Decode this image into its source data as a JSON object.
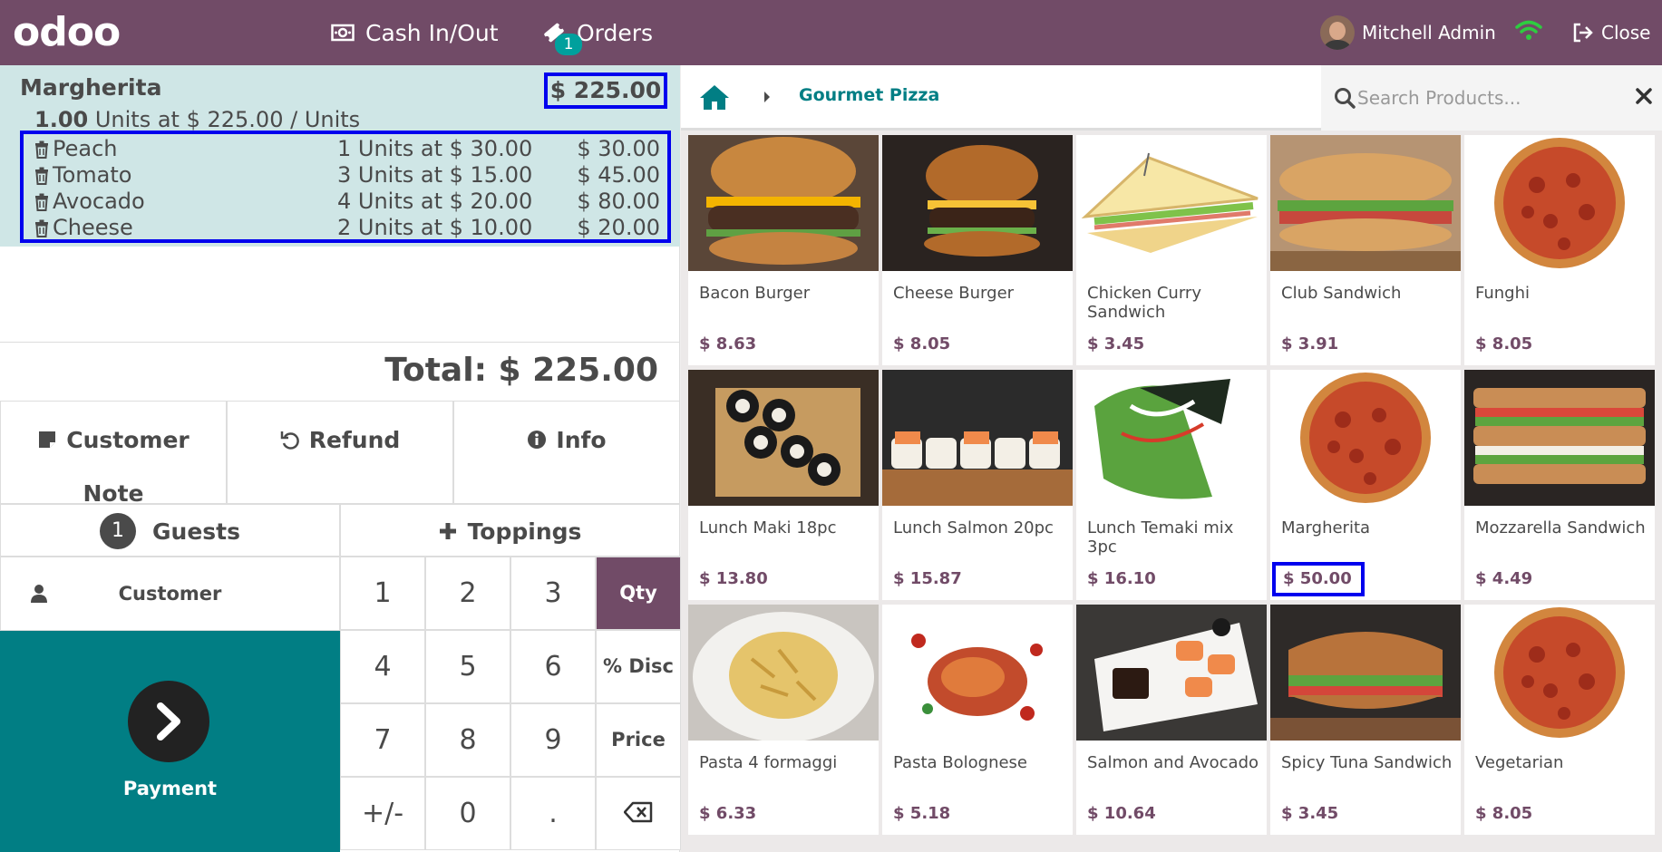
{
  "topbar": {
    "logo": "odoo",
    "cash_label": "Cash In/Out",
    "orders_label": "Orders",
    "orders_count": "1",
    "user_name": "Mitchell Admin",
    "close_label": "Close"
  },
  "order": {
    "line_name": "Margherita",
    "line_price": "$ 225.00",
    "line_qty": "1.00",
    "line_info": "Units at $ 225.00 / Units",
    "toppings": [
      {
        "name": "Peach",
        "qty": "1 Units at $ 30.00",
        "price": "$ 30.00"
      },
      {
        "name": "Tomato",
        "qty": "3 Units at $ 15.00",
        "price": "$ 45.00"
      },
      {
        "name": "Avocado",
        "qty": "4 Units at $ 20.00",
        "price": "$ 80.00"
      },
      {
        "name": "Cheese",
        "qty": "2 Units at $ 10.00",
        "price": "$ 20.00"
      }
    ],
    "total": "Total: $ 225.00"
  },
  "controls": {
    "customer_note_1": "Customer",
    "customer_note_2": "Note",
    "refund": "Refund",
    "info": "Info",
    "guests_count": "1",
    "guests": "Guests",
    "toppings": "Toppings",
    "customer": "Customer",
    "payment": "Payment"
  },
  "numpad": {
    "keys": [
      "1",
      "2",
      "3",
      "4",
      "5",
      "6",
      "7",
      "8",
      "9",
      "+/-",
      "0",
      "."
    ],
    "modes": [
      "Qty",
      "% Disc",
      "Price"
    ],
    "active_mode": "Qty"
  },
  "products_header": {
    "breadcrumb": "Gourmet Pizza",
    "search_placeholder": "Search Products..."
  },
  "products": [
    {
      "name": "Bacon Burger",
      "price": "$ 8.63"
    },
    {
      "name": "Cheese Burger",
      "price": "$ 8.05"
    },
    {
      "name": "Chicken Curry Sandwich",
      "price": "$ 3.45"
    },
    {
      "name": "Club Sandwich",
      "price": "$ 3.91"
    },
    {
      "name": "Funghi",
      "price": "$ 8.05"
    },
    {
      "name": "Lunch Maki 18pc",
      "price": "$ 13.80"
    },
    {
      "name": "Lunch Salmon 20pc",
      "price": "$ 15.87"
    },
    {
      "name": "Lunch Temaki mix 3pc",
      "price": "$ 16.10"
    },
    {
      "name": "Margherita",
      "price": "$ 50.00"
    },
    {
      "name": "Mozzarella Sandwich",
      "price": "$ 4.49"
    },
    {
      "name": "Pasta 4 formaggi",
      "price": "$ 6.33"
    },
    {
      "name": "Pasta Bolognese",
      "price": "$ 5.18"
    },
    {
      "name": "Salmon and Avocado",
      "price": "$ 10.64"
    },
    {
      "name": "Spicy Tuna Sandwich",
      "price": "$ 3.45"
    },
    {
      "name": "Vegetarian",
      "price": "$ 8.05"
    }
  ],
  "colors": {
    "brand": "#714b67",
    "accent": "#017e84",
    "highlight_box": "#0000ee"
  }
}
